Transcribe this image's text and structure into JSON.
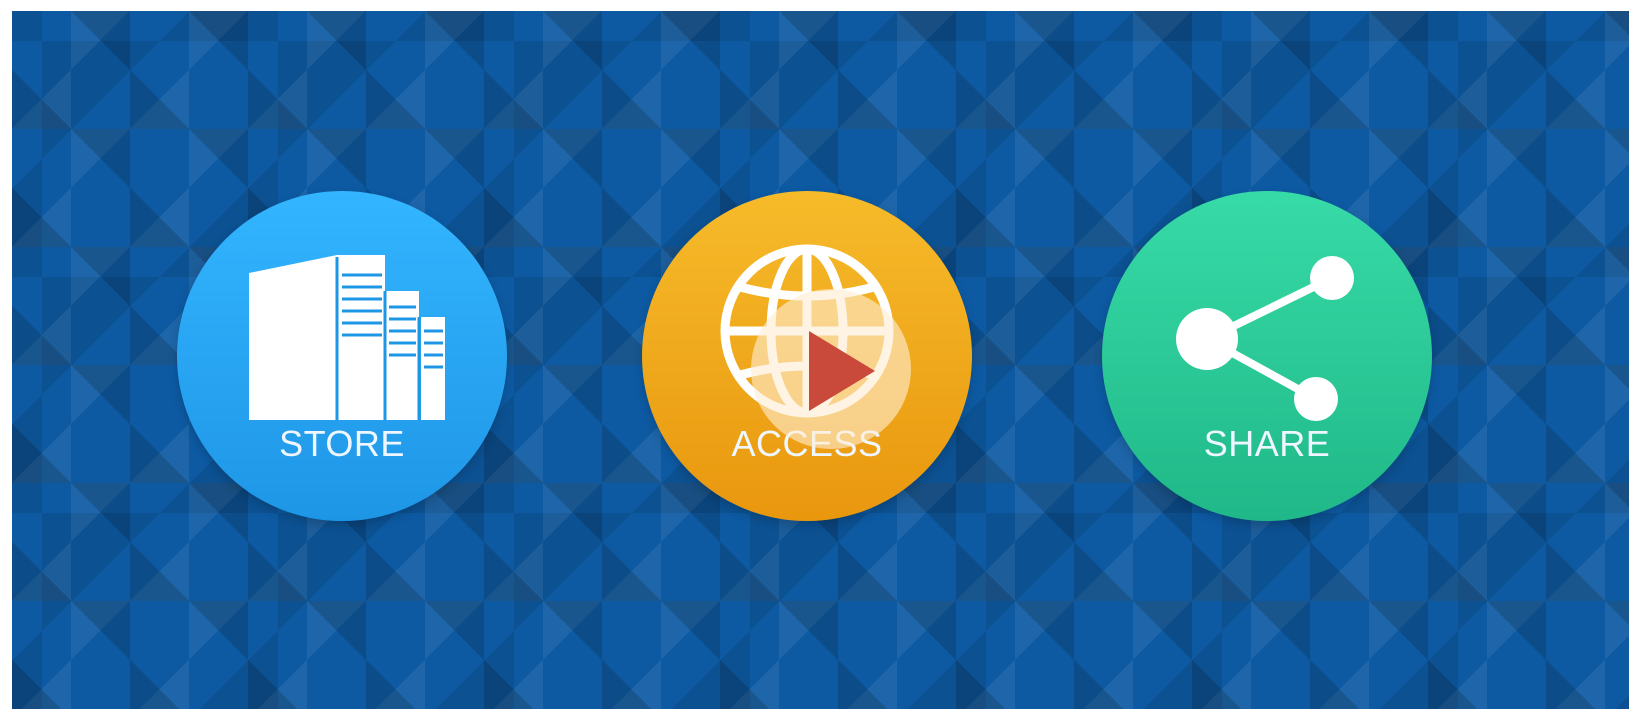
{
  "features": [
    {
      "id": "store",
      "label": "STORE",
      "icon": "buildings-icon",
      "color": "#2aa8f5"
    },
    {
      "id": "access",
      "label": "ACCESS",
      "icon": "globe-icon",
      "color": "#f2aa1d"
    },
    {
      "id": "share",
      "label": "SHARE",
      "icon": "share-icon",
      "color": "#2ccb9a"
    }
  ],
  "video": {
    "play_icon": "play-icon",
    "play_color": "#c94a3a",
    "background_color": "#0d5aa3"
  }
}
